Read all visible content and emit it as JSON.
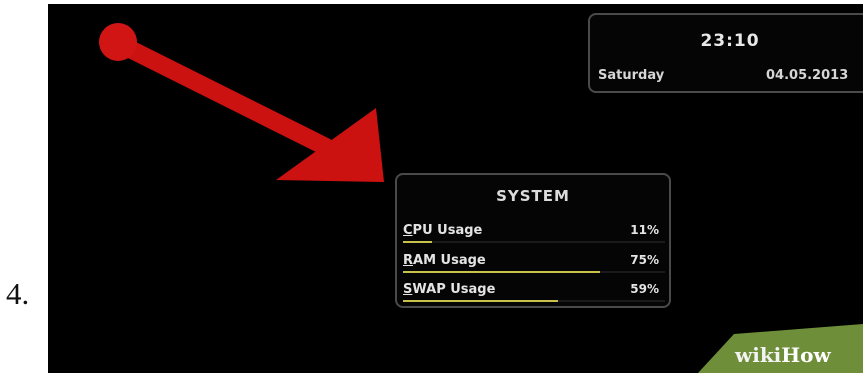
{
  "step": "4.",
  "clock": {
    "time": "23:10",
    "day": "Saturday",
    "date": "04.05.2013"
  },
  "system": {
    "title": "SYSTEM",
    "rows": [
      {
        "label": "CPU Usage",
        "value": "11%",
        "fraction": 0.11
      },
      {
        "label": "RAM Usage",
        "value": "75%",
        "fraction": 0.75
      },
      {
        "label": "SWAP Usage",
        "value": "59%",
        "fraction": 0.59
      }
    ]
  },
  "watermark": {
    "part1": "wiki",
    "part2": "How"
  },
  "colors": {
    "arrow": "#cc1111",
    "bar_fill": "#c8c24a",
    "watermark_bg": "#6f8e3a"
  },
  "icons": [
    "pointer-arrow"
  ]
}
